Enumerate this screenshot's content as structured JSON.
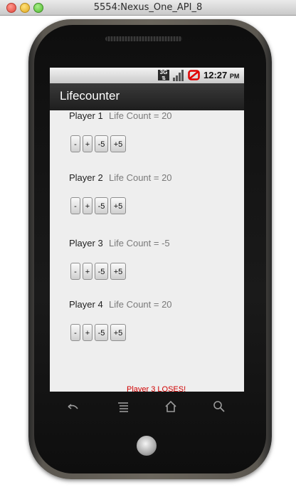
{
  "window": {
    "title": "5554:Nexus_One_API_8"
  },
  "statusbar": {
    "network": "3G",
    "time": "12:27",
    "ampm": "PM"
  },
  "app": {
    "title": "Lifecounter"
  },
  "buttons": {
    "minus": "-",
    "plus": "+",
    "minus5": "-5",
    "plus5": "+5"
  },
  "players": [
    {
      "name": "Player 1",
      "life": "Life Count = 20"
    },
    {
      "name": "Player 2",
      "life": "Life Count = 20"
    },
    {
      "name": "Player 3",
      "life": "Life Count = -5"
    },
    {
      "name": "Player 4",
      "life": "Life Count = 20"
    }
  ],
  "message": {
    "text": "Player 3 LOSES!",
    "color": "#d00000"
  },
  "nav": {
    "icons": [
      "back-icon",
      "menu-icon",
      "home-icon",
      "search-icon"
    ]
  }
}
